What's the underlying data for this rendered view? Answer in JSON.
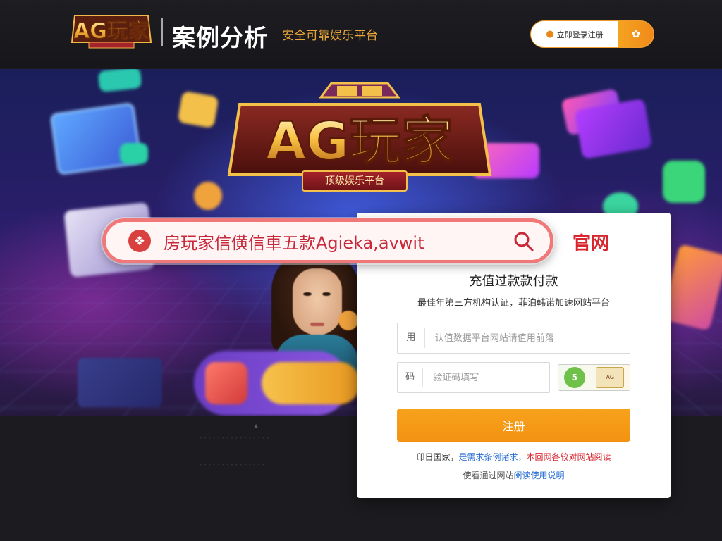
{
  "header": {
    "logo_text": "AG玩家",
    "title": "案例分析",
    "subtitle": "安全可靠娱乐平台",
    "cta_label": "立即登录注册",
    "cta_icon": "user-icon",
    "cta_right_icon": "bag-icon"
  },
  "hero": {
    "logo_text": "AG玩家",
    "badge_text": "顶级娱乐平台"
  },
  "search": {
    "text": "房玩家信僙信車五款Agieka,avwit",
    "icon": "search-icon"
  },
  "panel": {
    "official_label": "官网",
    "title": "充值过款款付款",
    "description": "最佳年第三方机构认证，菲泊韩诺加速网站平台",
    "field_account_placeholder": "认值数据平台网站请值用前落",
    "field_account_icon": "用",
    "field_code_placeholder": "验证码填写",
    "field_code_icon": "码",
    "captcha_left": "5",
    "captcha_right": "AG",
    "submit_label": "注册",
    "notice_part1": "印日国家，",
    "notice_part2": "是需求条例诸求，",
    "notice_part3": "本回网各较对网站阅读",
    "notice_line2_part1": "使看通过网站",
    "notice_line2_part2": "阅读使用说明"
  },
  "footer": {
    "line1": "·  ·  ·  ·  ·  ·  ·  ·  ·  ·  ·  ·  ·  ·  ·  ·",
    "line2": "·  ·  ·  ·  ·  ·  ·  ·  ·  ·  ·  ·  ·  ·  ·"
  },
  "colors": {
    "accent": "#f39a1e",
    "brand_red": "#d8262e",
    "search_border": "#f07878",
    "header_bg": "#1e1d21"
  }
}
